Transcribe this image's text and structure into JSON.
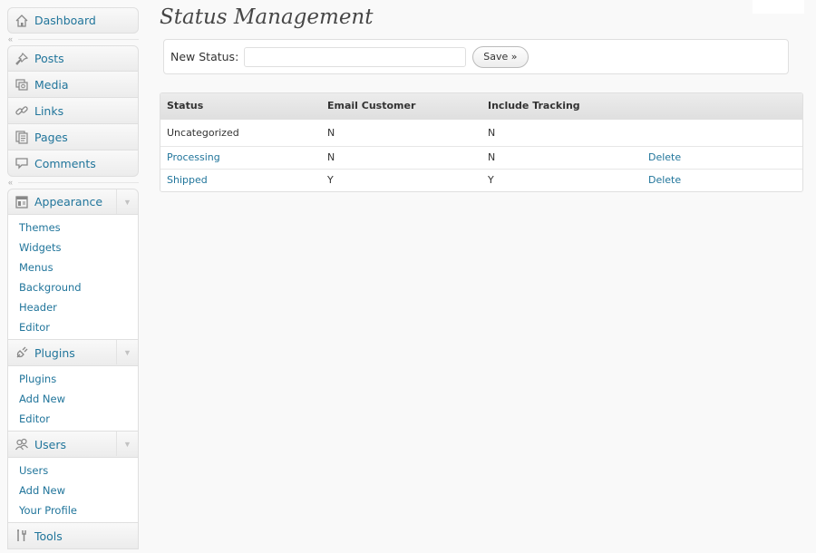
{
  "sidebar": {
    "dashboard": {
      "label": "Dashboard",
      "icon": "home-icon"
    },
    "posts": {
      "label": "Posts",
      "icon": "pin-icon"
    },
    "media": {
      "label": "Media",
      "icon": "media-icon"
    },
    "links": {
      "label": "Links",
      "icon": "link-icon"
    },
    "pages": {
      "label": "Pages",
      "icon": "pages-icon"
    },
    "comments": {
      "label": "Comments",
      "icon": "comment-icon"
    },
    "appearance": {
      "label": "Appearance",
      "icon": "appearance-icon",
      "items": [
        "Themes",
        "Widgets",
        "Menus",
        "Background",
        "Header",
        "Editor"
      ]
    },
    "plugins": {
      "label": "Plugins",
      "icon": "plug-icon",
      "items": [
        "Plugins",
        "Add New",
        "Editor"
      ]
    },
    "users": {
      "label": "Users",
      "icon": "users-icon",
      "items": [
        "Users",
        "Add New",
        "Your Profile"
      ]
    },
    "tools": {
      "label": "Tools",
      "icon": "tools-icon"
    }
  },
  "page": {
    "title": "Status Management"
  },
  "form": {
    "label": "New Status:",
    "value": "",
    "placeholder": "",
    "save_label": "Save »"
  },
  "table": {
    "headers": [
      "Status",
      "Email Customer",
      "Include Tracking",
      ""
    ],
    "rows": [
      {
        "status": "Uncategorized",
        "email": "N",
        "tracking": "N",
        "action": ""
      },
      {
        "status": "Processing",
        "email": "N",
        "tracking": "N",
        "action": "Delete"
      },
      {
        "status": "Shipped",
        "email": "Y",
        "tracking": "Y",
        "action": "Delete"
      }
    ]
  },
  "colors": {
    "link": "#21759b",
    "title": "#464646",
    "background": "#f9f9f9"
  }
}
